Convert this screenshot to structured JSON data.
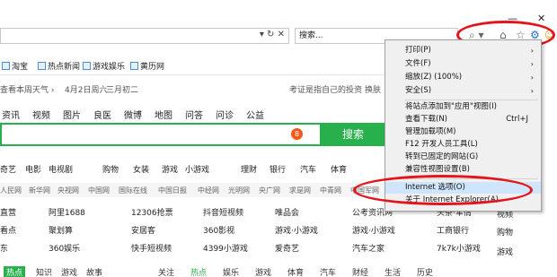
{
  "window": {
    "minimize": "—",
    "close": "✕"
  },
  "address": {
    "nav_glyphs": "▾ ↻ ✕"
  },
  "search": {
    "value": "搜索...",
    "dropdown": "⌕ ▾"
  },
  "favorites": [
    "淘宝",
    "热点新闻",
    "游戏娱乐",
    "黄历网"
  ],
  "strip": {
    "weather": "查看本周天气 ›",
    "date": "4月2日周六",
    "lunar": "三月初二",
    "notice": "考证是指自己的投资",
    "switch": "换肤"
  },
  "nav": [
    "资讯",
    "视频",
    "图片",
    "良医",
    "微博",
    "地图",
    "问答",
    "问诊",
    "公益"
  ],
  "searchbox": {
    "badge": "8",
    "button": "搜索"
  },
  "categories": [
    "奇艺",
    "电影",
    "电视剧",
    "购物",
    "女装",
    "游戏",
    "小游戏",
    "理财",
    "银行",
    "汽车",
    "体育"
  ],
  "media": [
    "人民网",
    "新华网",
    "央视网",
    "中国网",
    "国际在线",
    "中国日报",
    "中经网",
    "光明网",
    "央广网",
    "求是网",
    "中青网",
    "中国军网"
  ],
  "grid_rows": [
    [
      "直营",
      "阿里1688",
      "12306抢票",
      "抖音短视频",
      "唯品会",
      "公考资讯网",
      "头条·军情"
    ],
    [
      "看点",
      "聚划算",
      "安居客",
      "360影视",
      "游戏·小游戏",
      "游戏·小游戏",
      "工商银行"
    ],
    [
      "东",
      "360娱乐",
      "快手短视频",
      "4399小游戏",
      "爱奇艺",
      "汽车之家",
      "7k7k小游戏"
    ]
  ],
  "bottom_tabs": [
    "热点",
    "知识",
    "游戏",
    "故事",
    "关注",
    "热点",
    "娱乐",
    "游戏",
    "体育",
    "汽车",
    "财经",
    "生活",
    "历史"
  ],
  "side": [
    "视频",
    "购物",
    "游戏"
  ],
  "menu": {
    "items": [
      {
        "label": "打印(P)",
        "arrow": "›"
      },
      {
        "label": "文件(F)",
        "arrow": "›"
      },
      {
        "label": "缩放(Z) (100%)",
        "arrow": "›"
      },
      {
        "label": "安全(S)",
        "arrow": "›"
      },
      {
        "label": "将站点添加到\"应用\"视图(I)"
      },
      {
        "label": "查看下载(N)",
        "key": "Ctrl+J"
      },
      {
        "label": "管理加载项(M)"
      },
      {
        "label": "F12 开发人员工具(L)"
      },
      {
        "label": "转到已固定的网站(G)"
      },
      {
        "label": "兼容性视图设置(B)"
      },
      {
        "label": "Internet 选项(O)"
      },
      {
        "label": "关于 Internet Explorer(A)"
      }
    ]
  },
  "colors": {
    "accent_green": "#27b04b",
    "annotation_red": "#e4141c",
    "menu_highlight": "#cfe5fb"
  }
}
